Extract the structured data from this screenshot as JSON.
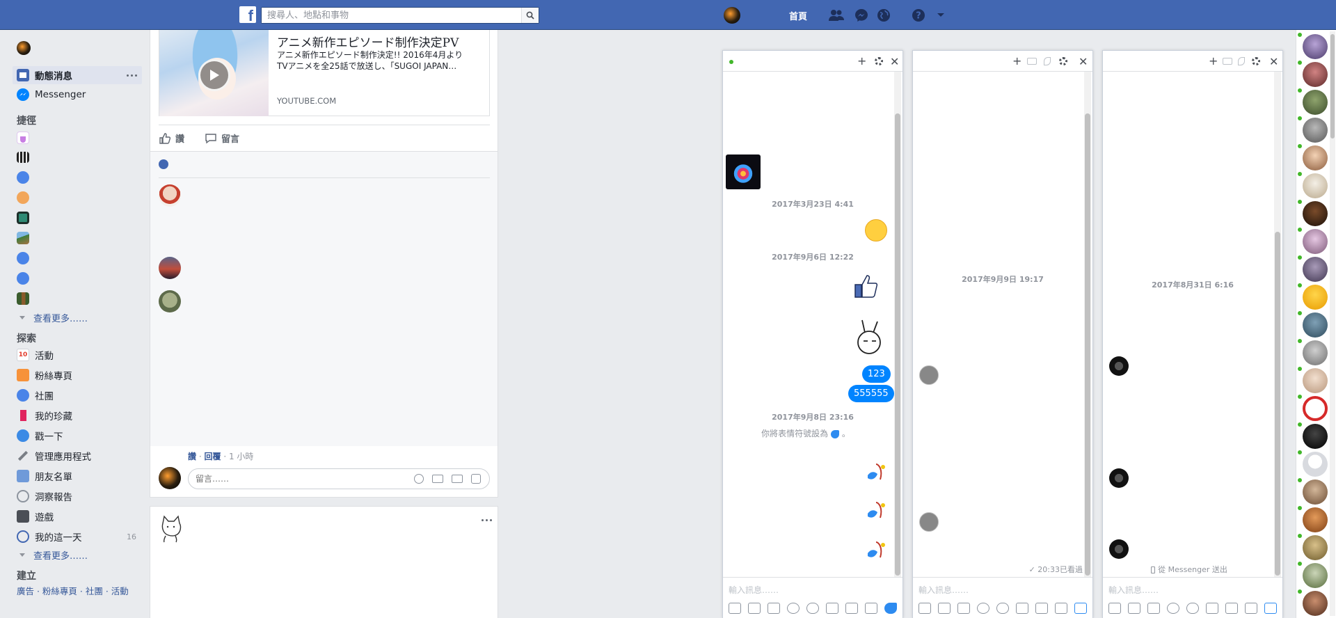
{
  "topbar": {
    "logo": "f",
    "search_placeholder": "搜尋人、地點和事物",
    "home_label": "首頁"
  },
  "leftnav": {
    "news_feed": "動態消息",
    "messenger": "Messenger",
    "shortcuts_heading": "捷徑",
    "see_more_1": "查看更多……",
    "explore_heading": "探索",
    "explore_items": [
      {
        "label": "活動",
        "badge": "10"
      },
      {
        "label": "粉絲專頁"
      },
      {
        "label": "社團"
      },
      {
        "label": "我的珍藏"
      },
      {
        "label": "戳一下"
      },
      {
        "label": "管理應用程式"
      },
      {
        "label": "朋友名單"
      },
      {
        "label": "洞察報告"
      },
      {
        "label": "遊戲"
      },
      {
        "label": "我的這一天",
        "count": "16"
      }
    ],
    "see_more_2": "查看更多……",
    "create_heading": "建立",
    "create_links": "廣告 · 粉絲專頁 · 社團 · 活動"
  },
  "feed": {
    "link_title": "アニメ新作エピソード制作決定PV",
    "link_desc_1": "アニメ新作エピソード制作決定!! 2016年4月より",
    "link_desc_2": "TVアニメを全25話で放送し、「SUGOI JAPAN…",
    "link_domain": "YOUTUBE.COM",
    "like_label": "讚",
    "comment_label": "留言",
    "reply_meta_like": "讚",
    "reply_meta_reply": "回覆",
    "reply_meta_time": "· 1 小時",
    "comment_placeholder": "留言……"
  },
  "chat1": {
    "date1": "2017年3月23日 4:41",
    "date2": "2017年9月6日 12:22",
    "bubble1": "123",
    "bubble2": "555555",
    "date3": "2017年9月8日 23:16",
    "system_msg": "你將表情符號設為",
    "system_msg_end": "。",
    "input_placeholder": "輸入訊息……"
  },
  "chat2": {
    "date1": "2017年9月9日 19:17",
    "seen": "20:33已看過",
    "input_placeholder": "輸入訊息……"
  },
  "chat3": {
    "date1": "2017年8月31日 6:16",
    "sent_via": "從 Messenger 送出",
    "input_placeholder": "輸入訊息……"
  },
  "colors": {
    "brand_blue": "#4267b2",
    "bubble_blue": "#0084ff",
    "link_blue": "#365899",
    "online_green": "#42b72a"
  }
}
